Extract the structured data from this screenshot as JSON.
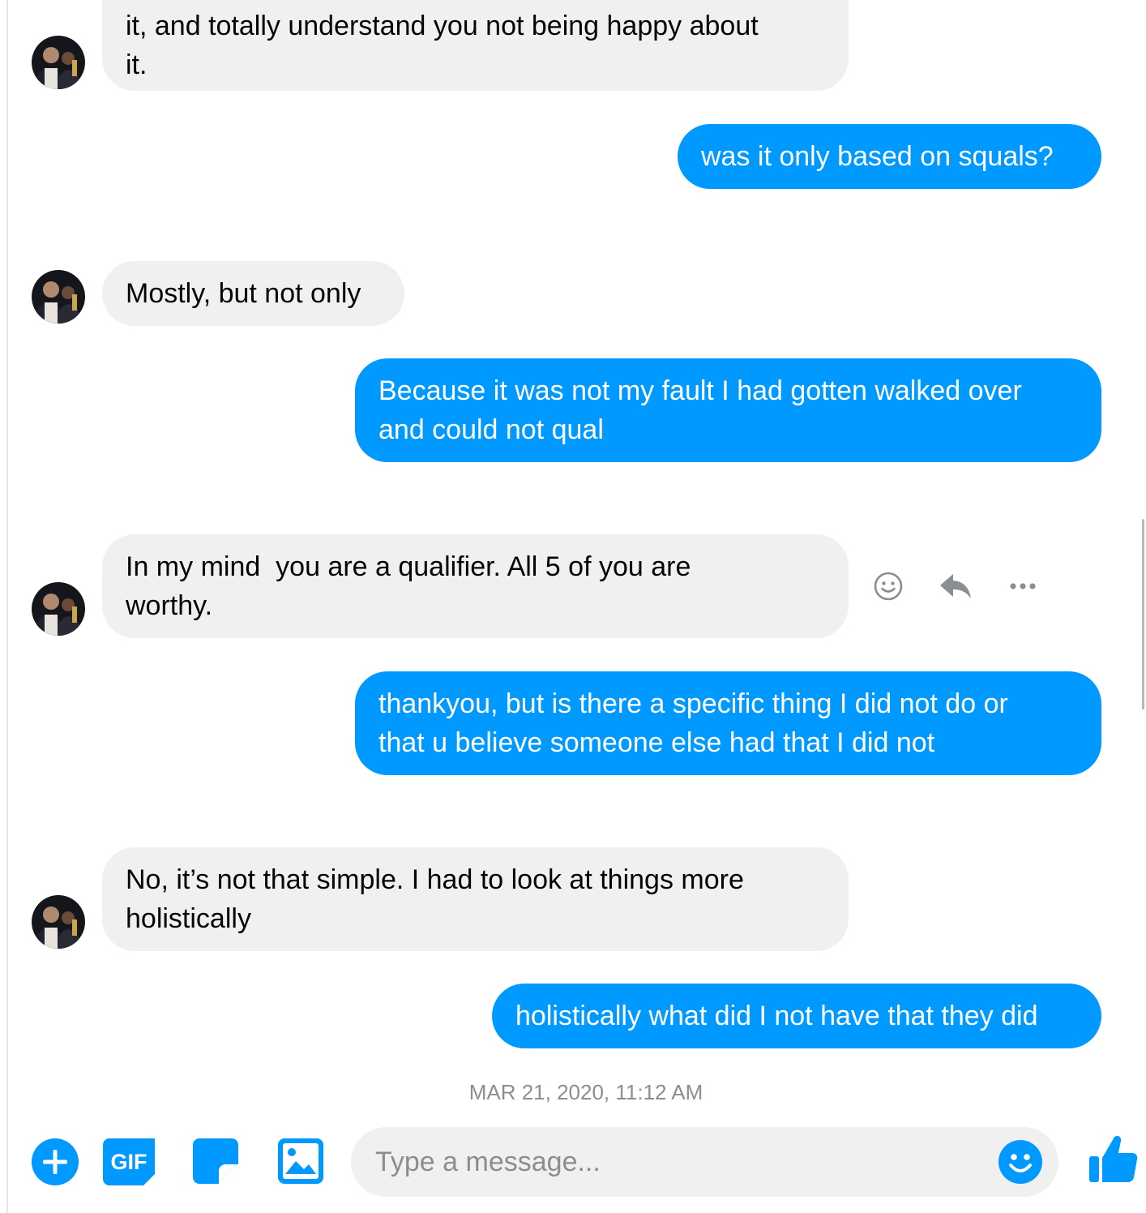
{
  "messages": [
    {
      "from": "them",
      "text": "it, and totally understand you not being happy about\nit."
    },
    {
      "from": "me",
      "text": "was it only based on squals?"
    },
    {
      "from": "them",
      "text": "Mostly, but not only"
    },
    {
      "from": "me",
      "text": "Because it was not my fault I had gotten walked over\nand could not qual"
    },
    {
      "from": "them",
      "text": "In my mind  you are a qualifier. All 5 of you are\nworthy."
    },
    {
      "from": "me",
      "text": "thankyou, but is there a specific thing I did not do or\nthat u believe someone else had that I did not"
    },
    {
      "from": "them",
      "text": "No, it’s not that simple. I had to look at things more\nholistically"
    },
    {
      "from": "me",
      "text": "holistically what did I not have that they did"
    }
  ],
  "timestamp": "MAR 21, 2020, 11:12 AM",
  "composer": {
    "gif_label": "GIF",
    "placeholder": "Type a message..."
  },
  "message_actions": [
    "react-icon",
    "reply-icon",
    "more-icon"
  ],
  "composer_icons": [
    "plus-icon",
    "gif-icon",
    "sticker-icon",
    "photo-icon",
    "emoji-icon",
    "thumbs-up-icon"
  ],
  "colors": {
    "outgoing_bubble": "#0099ff",
    "incoming_bubble": "#f0f0f0",
    "accent": "#0099ff",
    "timestamp": "#8a8d91"
  }
}
